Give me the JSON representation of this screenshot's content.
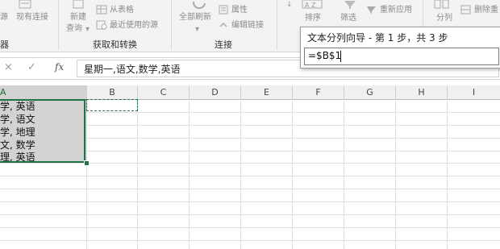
{
  "ribbon": {
    "btn_source": "源",
    "btn_existing": "现有连接",
    "btn_new_query": "新建",
    "btn_new_query_2": "查询",
    "btn_from_table": "从表格",
    "btn_recent": "最近使用的源",
    "group_get_transform": "获取和转换",
    "btn_refresh_all": "全部刷新",
    "btn_properties": "属性",
    "btn_edit_links": "编辑链接",
    "group_connections": "连接",
    "btn_sort": "排序",
    "btn_filter": "筛选",
    "btn_reapply": "重新应用",
    "btn_split": "分列",
    "btn_remove_dup": "删除重",
    "group_left_stub": "器"
  },
  "formula_bar": {
    "cancel": "×",
    "enter": "✓",
    "fx": "fx",
    "value": "星期一,语文,数学,英语"
  },
  "columns": [
    "A",
    "B",
    "C",
    "D",
    "E",
    "F",
    "G",
    "H",
    "I"
  ],
  "cells_a": [
    "学, 英语",
    "学, 语文",
    "学, 地理",
    "文, 数学",
    "理, 英语"
  ],
  "wizard": {
    "title": "文本分列向导 - 第 1 步，共 3 步",
    "ref": "=$B$1"
  },
  "colors": {
    "accent": "#217346",
    "selection": "#d3d3d3"
  }
}
